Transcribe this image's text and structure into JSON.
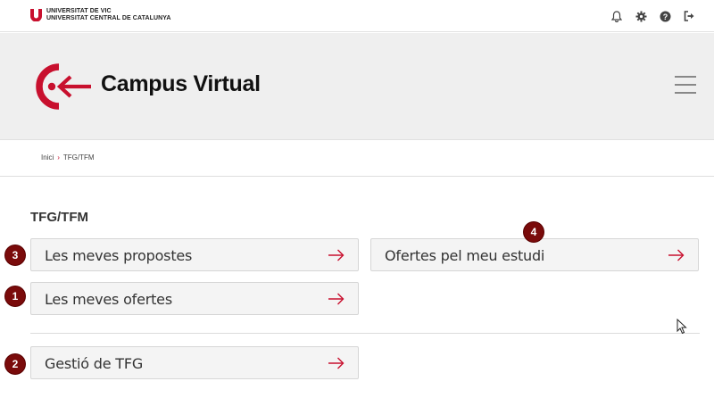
{
  "topbar": {
    "university_line1": "UNIVERSITAT DE VIC",
    "university_line2": "UNIVERSITAT CENTRAL DE CATALUNYA",
    "icons": [
      "bell-icon",
      "gear-icon",
      "help-icon",
      "logout-icon"
    ]
  },
  "header": {
    "title": "Campus Virtual"
  },
  "breadcrumb": {
    "home": "Inici",
    "separator": "›",
    "current": "TFG/TFM"
  },
  "main": {
    "title": "TFG/TFM",
    "cards": [
      {
        "label": "Les meves propostes",
        "badge": "3"
      },
      {
        "label": "Ofertes pel meu estudi",
        "badge": "4"
      },
      {
        "label": "Les meves ofertes",
        "badge": "1"
      },
      {
        "label": "Gestió de TFG",
        "badge": "2"
      }
    ]
  },
  "colors": {
    "brand_red": "#c8102e",
    "badge": "#7a0b0b",
    "header_bg": "#efefef"
  }
}
